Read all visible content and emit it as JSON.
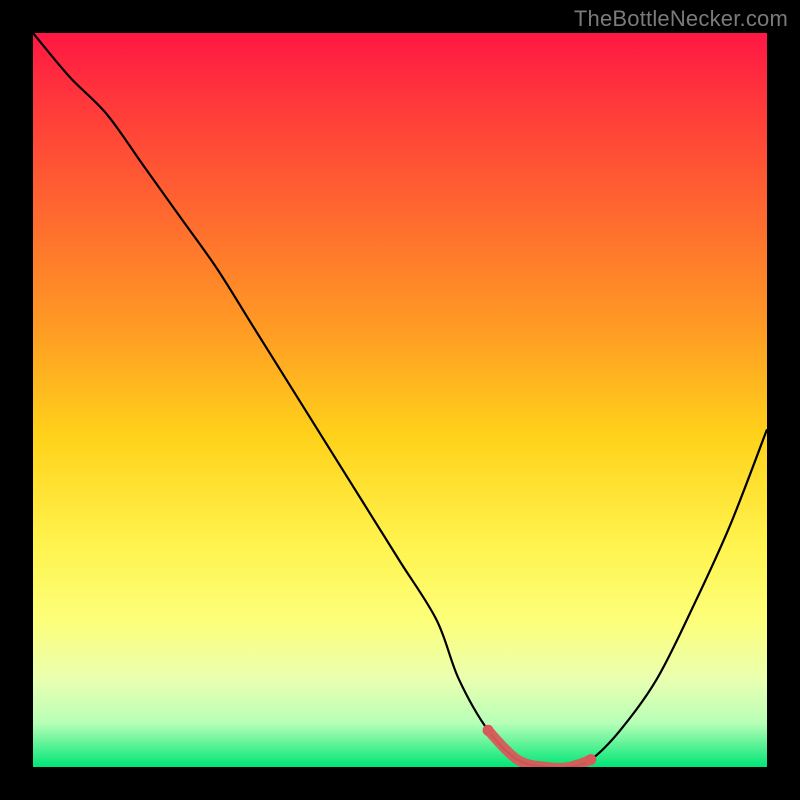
{
  "watermark": "TheBottleNecker.com",
  "colors": {
    "frame": "#000000",
    "curve": "#000000",
    "highlight": "#d95a5a",
    "gradient_top": "#ff1744",
    "gradient_bottom": "#00e676"
  },
  "chart_data": {
    "type": "line",
    "title": "",
    "xlabel": "",
    "ylabel": "",
    "xlim": [
      0,
      100
    ],
    "ylim": [
      0,
      100
    ],
    "x": [
      0,
      5,
      10,
      15,
      20,
      25,
      30,
      35,
      40,
      45,
      50,
      55,
      58,
      62,
      66,
      70,
      73,
      76,
      80,
      85,
      90,
      95,
      100
    ],
    "series": [
      {
        "name": "bottleneck-curve",
        "values": [
          100,
          94,
          89,
          82,
          75,
          68,
          60,
          52,
          44,
          36,
          28,
          20,
          12,
          5,
          1,
          0,
          0,
          1,
          5,
          12,
          22,
          33,
          46
        ]
      }
    ],
    "highlight_region": {
      "x_start": 62,
      "x_end": 76
    }
  }
}
